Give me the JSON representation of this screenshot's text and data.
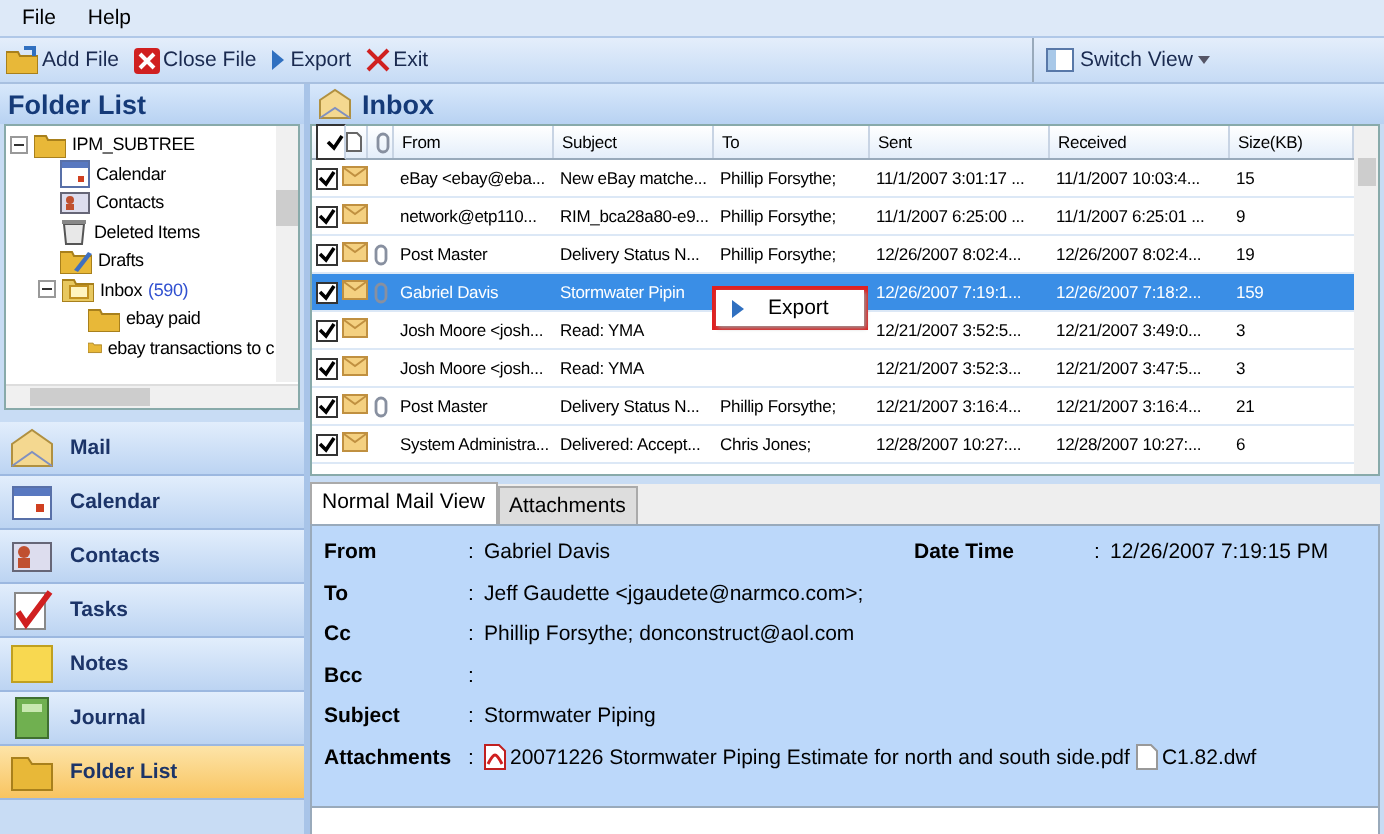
{
  "menu": [
    "File",
    "Help"
  ],
  "toolbar": [
    {
      "kind": "add",
      "label": "Add File"
    },
    {
      "kind": "close",
      "label": "Close File"
    },
    {
      "kind": "export",
      "label": "Export"
    },
    {
      "kind": "exit",
      "label": "Exit"
    }
  ],
  "switch_view": "Switch View",
  "folder_panel": {
    "title": "Folder List",
    "tree": [
      {
        "label": "IPM_SUBTREE",
        "kind": "folder",
        "expanded": true,
        "children": [
          {
            "label": "Calendar",
            "kind": "calendar"
          },
          {
            "label": "Contacts",
            "kind": "contacts"
          },
          {
            "label": "Deleted Items",
            "kind": "trash"
          },
          {
            "label": "Drafts",
            "kind": "drafts"
          },
          {
            "label": "Inbox",
            "count": "(590)",
            "kind": "inbox",
            "expanded": true,
            "children": [
              {
                "label": "ebay paid",
                "kind": "folder"
              },
              {
                "label": "ebay transactions to c",
                "kind": "folder"
              }
            ]
          }
        ]
      }
    ]
  },
  "nav": [
    {
      "label": "Mail",
      "kind": "mail",
      "selected": false
    },
    {
      "label": "Calendar",
      "kind": "calendar",
      "selected": false
    },
    {
      "label": "Contacts",
      "kind": "contacts",
      "selected": false
    },
    {
      "label": "Tasks",
      "kind": "tasks",
      "selected": false
    },
    {
      "label": "Notes",
      "kind": "notes",
      "selected": false
    },
    {
      "label": "Journal",
      "kind": "journal",
      "selected": false
    },
    {
      "label": "Folder List",
      "kind": "folder",
      "selected": true
    }
  ],
  "inbox": {
    "title": "Inbox",
    "all_checked": true,
    "columns": [
      "From",
      "Subject",
      "To",
      "Sent",
      "Received",
      "Size(KB)"
    ],
    "rows": [
      {
        "checked": true,
        "attachment": false,
        "selected": false,
        "cells": [
          "eBay <ebay@eba...",
          "New eBay matche...",
          "Phillip Forsythe;",
          "11/1/2007 3:01:17 ...",
          "11/1/2007 10:03:4...",
          "15"
        ]
      },
      {
        "checked": true,
        "attachment": false,
        "selected": false,
        "cells": [
          "network@etp110...",
          "RIM_bca28a80-e9...",
          "Phillip Forsythe;",
          "11/1/2007 6:25:00 ...",
          "11/1/2007 6:25:01 ...",
          "9"
        ]
      },
      {
        "checked": true,
        "attachment": true,
        "selected": false,
        "cells": [
          "Post Master",
          "Delivery Status N...",
          "Phillip Forsythe;",
          "12/26/2007 8:02:4...",
          "12/26/2007 8:02:4...",
          "19"
        ]
      },
      {
        "checked": true,
        "attachment": true,
        "selected": true,
        "cells": [
          "Gabriel Davis",
          "Stormwater Pipin",
          "",
          "12/26/2007 7:19:1...",
          "12/26/2007 7:18:2...",
          "159"
        ]
      },
      {
        "checked": true,
        "attachment": false,
        "selected": false,
        "cells": [
          "Josh Moore <josh...",
          "Read: YMA",
          "",
          "12/21/2007 3:52:5...",
          "12/21/2007 3:49:0...",
          "3"
        ]
      },
      {
        "checked": true,
        "attachment": false,
        "selected": false,
        "cells": [
          "Josh Moore <josh...",
          "Read: YMA",
          "",
          "12/21/2007 3:52:3...",
          "12/21/2007 3:47:5...",
          "3"
        ]
      },
      {
        "checked": true,
        "attachment": true,
        "selected": false,
        "cells": [
          "Post Master",
          "Delivery Status N...",
          "Phillip Forsythe;",
          "12/21/2007 3:16:4...",
          "12/21/2007 3:16:4...",
          "21"
        ]
      },
      {
        "checked": true,
        "attachment": false,
        "selected": false,
        "cells": [
          "System Administra...",
          "Delivered: Accept...",
          "Chris Jones;",
          "12/28/2007 10:27:...",
          "12/28/2007 10:27:...",
          "6"
        ]
      }
    ],
    "context_menu": [
      "Export"
    ]
  },
  "preview": {
    "tabs": [
      {
        "label": "Normal Mail View",
        "selected": true
      },
      {
        "label": "Attachments",
        "selected": false
      }
    ],
    "fields": [
      {
        "label": "From",
        "separator": ":",
        "value": "Gabriel Davis"
      },
      {
        "label": "To",
        "separator": ":",
        "value": "Jeff Gaudette <jgaudete@narmco.com>;"
      },
      {
        "label": "Cc",
        "separator": ":",
        "value": "Phillip Forsythe; donconstruct@aol.com"
      },
      {
        "label": "Bcc",
        "separator": ":"
      },
      {
        "label": "Subject",
        "separator": ":",
        "value": "Stormwater Piping"
      }
    ],
    "date_time": {
      "label": "Date Time",
      "separator": ":",
      "value": "12/26/2007 7:19:15 PM"
    },
    "attachments": {
      "label": "Attachments",
      "separator": ":",
      "files": [
        {
          "kind": "pdf",
          "name": "20071226 Stormwater Piping Estimate for north and south side.pdf"
        },
        {
          "kind": "file",
          "name": "C1.82.dwf"
        }
      ]
    }
  }
}
